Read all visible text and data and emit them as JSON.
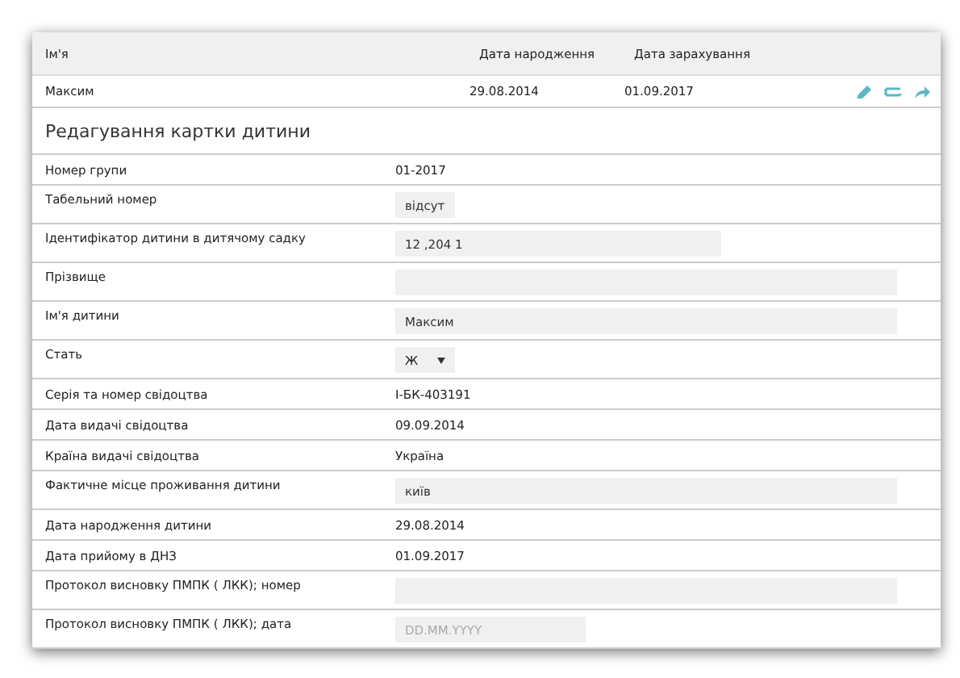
{
  "table": {
    "columns": [
      "Ім'я",
      "Дата народження",
      "Дата зарахування"
    ],
    "rows": [
      {
        "name": "Максим",
        "birth_date": "29.08.2014",
        "enroll_date": "01.09.2017"
      }
    ]
  },
  "form": {
    "title": "Редагування картки дитини",
    "fields": [
      {
        "kind": "text",
        "label": "Номер групи",
        "value": "01-2017"
      },
      {
        "kind": "short",
        "label": "Табельний номер",
        "value": "відсут"
      },
      {
        "kind": "medium",
        "label": "Ідентифікатор дитини в дитячому садку",
        "value": "12 ,204 1"
      },
      {
        "kind": "long",
        "label": "Прізвище"
      },
      {
        "kind": "long",
        "label": "Ім'я дитини",
        "value": "Максим"
      },
      {
        "kind": "select",
        "label": "Стать",
        "value": "Ж"
      },
      {
        "kind": "text",
        "label": "Серія та номер свідоцтва",
        "value": "І-БК-403191"
      },
      {
        "kind": "text",
        "label": "Дата видачі свідоцтва",
        "value": "09.09.2014"
      },
      {
        "kind": "text",
        "label": "Країна видачі свідоцтва",
        "value": "Україна"
      },
      {
        "kind": "long",
        "label": "Фактичне місце проживання дитини",
        "value": "київ"
      },
      {
        "kind": "text",
        "label": "Дата народження дитини",
        "value": "29.08.2014"
      },
      {
        "kind": "text",
        "label": "Дата прийому в ДНЗ",
        "value": "01.09.2017"
      },
      {
        "kind": "long",
        "label": "Протокол висновку ПМПК ( ЛКК); номер"
      },
      {
        "kind": "date",
        "label": "Протокол висновку ПМПК ( ЛКК); дата",
        "placeholder": "DD.MM.YYYY"
      }
    ]
  }
}
